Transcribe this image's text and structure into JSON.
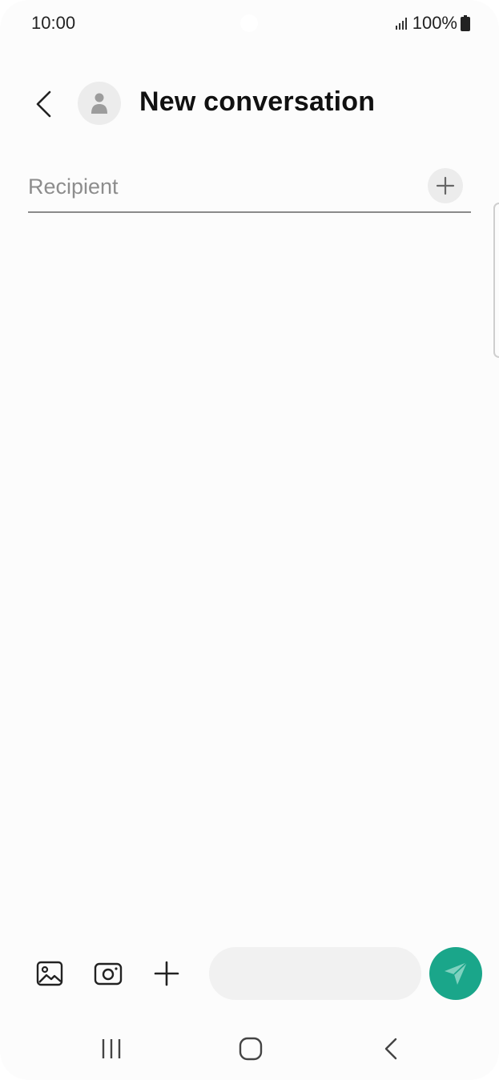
{
  "status_bar": {
    "time": "10:00",
    "battery_text": "100%",
    "icons": [
      "signal-icon",
      "battery-icon"
    ]
  },
  "header": {
    "title": "New conversation",
    "back_icon": "chevron-left-icon",
    "avatar_icon": "person-icon"
  },
  "recipient": {
    "placeholder": "Recipient",
    "value": "",
    "add_icon": "plus-icon"
  },
  "compose": {
    "tools": [
      "gallery-icon",
      "camera-icon",
      "plus-icon"
    ],
    "message_placeholder": "",
    "message_value": "",
    "send_icon": "send-icon",
    "send_color": "#1aa68a"
  },
  "nav_bar": {
    "buttons": [
      "recent-apps-icon",
      "home-icon",
      "back-icon"
    ]
  },
  "colors": {
    "background": "#fcfcfc",
    "accent": "#1aa68a",
    "text_primary": "#111111",
    "placeholder": "#8d8d8d"
  }
}
